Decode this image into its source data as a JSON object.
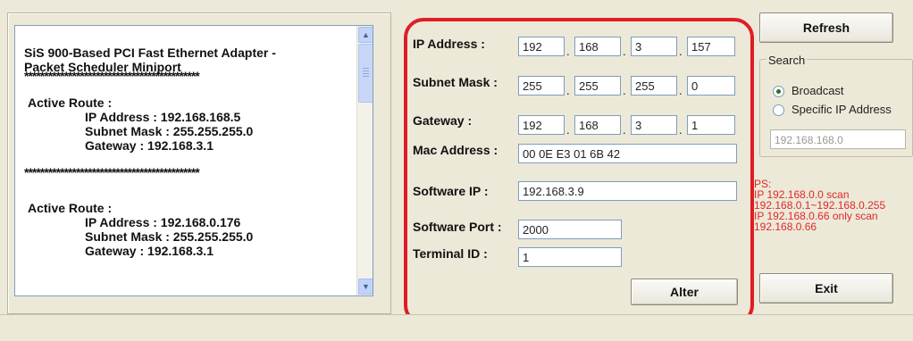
{
  "route_list": {
    "title_line1": "SiS 900-Based PCI Fast Ethernet Adapter -",
    "title_line2": "Packet Scheduler Miniport",
    "separator": "********************************************",
    "routes": [
      {
        "heading": "Active Route :",
        "ip": "IP Address : 192.168.168.5",
        "mask": "Subnet Mask : 255.255.255.0",
        "gateway": "Gateway : 192.168.3.1"
      },
      {
        "heading": "Active Route :",
        "ip": "IP Address : 192.168.0.176",
        "mask": "Subnet Mask : 255.255.255.0",
        "gateway": "Gateway : 192.168.3.1"
      }
    ],
    "scroll_up": "▲",
    "scroll_down": "▼"
  },
  "config": {
    "ip_label": "IP Address :",
    "ip": [
      "192",
      "168",
      "3",
      "157"
    ],
    "mask_label": "Subnet Mask :",
    "mask": [
      "255",
      "255",
      "255",
      "0"
    ],
    "gateway_label": "Gateway :",
    "gateway": [
      "192",
      "168",
      "3",
      "1"
    ],
    "mac_label": "Mac Address :",
    "mac": "00 0E E3 01 6B 42",
    "software_ip_label": "Software IP :",
    "software_ip": "192.168.3.9",
    "software_port_label": "Software Port :",
    "software_port": "2000",
    "terminal_id_label": "Terminal ID :",
    "terminal_id": "1",
    "alter_label": "Alter",
    "octet_dot": "."
  },
  "search": {
    "refresh_label": "Refresh",
    "group_title": "Search",
    "broadcast_label": "Broadcast",
    "specific_label": "Specific IP Address",
    "selected": "Broadcast",
    "specific_ip": "192.168.168.0",
    "exit_label": "Exit"
  },
  "ps_note": {
    "line1": "PS:",
    "line2": "IP 192.168.0.0 scan",
    "line3": "192.168.0.1~192.168.0.255",
    "line4": "IP 192.168.0.66 only scan",
    "line5": "192.168.0.66"
  },
  "colors": {
    "highlight_border": "#e01c26",
    "ps_text": "#e0282a"
  }
}
